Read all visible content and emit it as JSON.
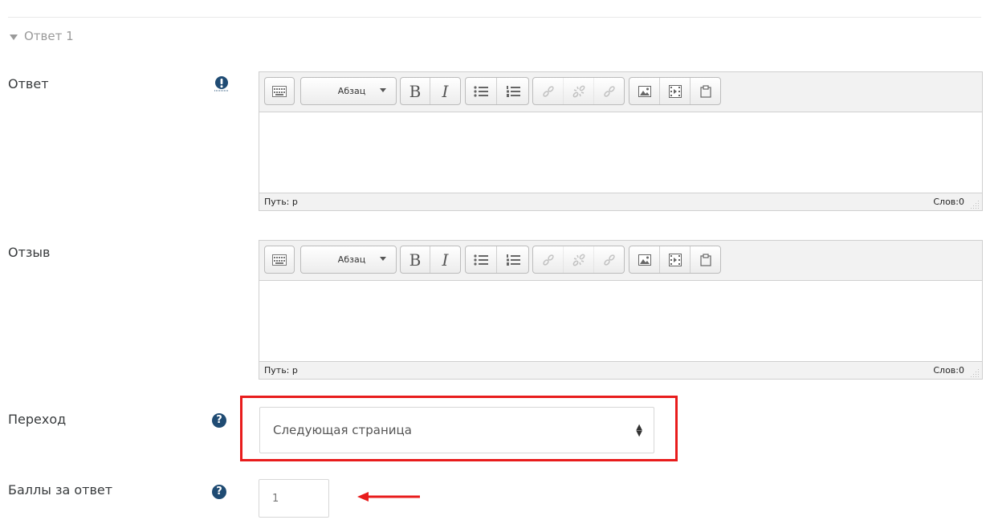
{
  "section": {
    "title": "Ответ 1"
  },
  "fields": {
    "answer_label": "Ответ",
    "feedback_label": "Отзыв",
    "jump_label": "Переход",
    "score_label": "Баллы за ответ"
  },
  "editor": {
    "format_value": "Абзац",
    "path_text": "Путь: p",
    "word_count": "Слов:0"
  },
  "jump_select": {
    "selected": "Следующая страница"
  },
  "score_input": {
    "value": "1"
  },
  "icons": {
    "required": "exclamation-circle-icon",
    "help": "question-circle-icon"
  },
  "colors": {
    "highlight": "#e81c1c",
    "help_icon": "#1f4b73"
  }
}
